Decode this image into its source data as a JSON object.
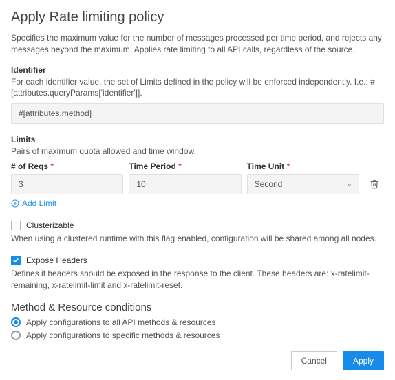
{
  "title": "Apply Rate limiting policy",
  "description": "Specifies the maximum value for the number of messages processed per time period, and rejects any messages beyond the maximum. Applies rate limiting to all API calls, regardless of the source.",
  "identifier": {
    "label": "Identifier",
    "help": "For each identifier value, the set of Limits defined in the policy will be enforced independently. I.e.: #[attributes.queryParams['identifier']].",
    "value": "#[attributes.method]"
  },
  "limits": {
    "label": "Limits",
    "help": "Pairs of maximum quota allowed and time window.",
    "columns": {
      "reqs": "# of Reqs",
      "period": "Time Period",
      "unit": "Time Unit"
    },
    "row": {
      "reqs": "3",
      "period": "10",
      "unit": "Second"
    },
    "add_label": "Add Limit"
  },
  "clusterizable": {
    "label": "Clusterizable",
    "checked": false,
    "help": "When using a clustered runtime with this flag enabled, configuration will be shared among all nodes."
  },
  "expose_headers": {
    "label": "Expose Headers",
    "checked": true,
    "help": "Defines if headers should be exposed in the response to the client. These headers are: x-ratelimit-remaining, x-ratelimit-limit and x-ratelimit-reset."
  },
  "conditions": {
    "heading": "Method & Resource conditions",
    "options": [
      "Apply configurations to all API methods & resources",
      "Apply configurations to specific methods & resources"
    ],
    "selected": 0
  },
  "footer": {
    "cancel": "Cancel",
    "apply": "Apply"
  },
  "required_mark": " *"
}
